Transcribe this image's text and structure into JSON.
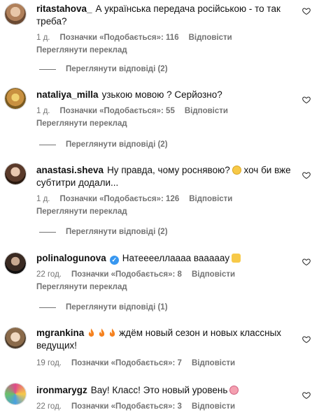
{
  "comments": [
    {
      "username": "ritastahova_",
      "text": "А українська передача російською - то так треба?",
      "time": "1 д.",
      "likes": "Позначки «Подобається»: 116",
      "reply": "Відповісти",
      "translate": "Переглянути переклад",
      "replies": "Переглянути відповіді (2)"
    },
    {
      "username": "nataliya_milla",
      "text": "узькою мовою ? Серйозно?",
      "time": "1 д.",
      "likes": "Позначки «Подобається»: 55",
      "reply": "Відповісти",
      "translate": "Переглянути переклад",
      "replies": "Переглянути відповіді (2)"
    },
    {
      "username": "anastasi.sheva",
      "text": "Ну правда, чому роснявою?",
      "text2": "хоч би вже субтитри додали...",
      "time": "1 д.",
      "likes": "Позначки «Подобається»: 126",
      "reply": "Відповісти",
      "translate": "Переглянути переклад",
      "replies": "Переглянути відповіді (2)"
    },
    {
      "username": "polinalogunova",
      "text": "Натееееллаааа ваааааy",
      "time": "22 год.",
      "likes": "Позначки «Подобається»: 8",
      "reply": "Відповісти",
      "translate": "Переглянути переклад",
      "replies": "Переглянути відповіді (1)"
    },
    {
      "username": "mgrankina",
      "text": "ждём новый сезон и новых классных ведущих!",
      "time": "19 год.",
      "likes": "Позначки «Подобається»: 7",
      "reply": "Відповісти"
    },
    {
      "username": "ironmarygz",
      "text": "Вау! Класс! Это новый уровень",
      "time": "22 год.",
      "likes": "Позначки «Подобається»: 3",
      "reply": "Відповісти"
    }
  ],
  "colors": {
    "secondary_text": "#737373",
    "verified": "#3897f0"
  },
  "icons": [
    "heart-icon",
    "verified-icon",
    "fire-emoji-icon",
    "face-emoji-icon"
  ]
}
